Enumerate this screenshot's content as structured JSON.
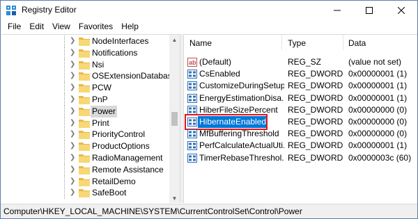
{
  "window": {
    "title": "Registry Editor"
  },
  "menu": [
    "File",
    "Edit",
    "View",
    "Favorites",
    "Help"
  ],
  "tree": {
    "items": [
      {
        "label": "NodeInterfaces",
        "selected": false
      },
      {
        "label": "Notifications",
        "selected": false
      },
      {
        "label": "Nsi",
        "selected": false
      },
      {
        "label": "OSExtensionDatabase",
        "selected": false
      },
      {
        "label": "PCW",
        "selected": false
      },
      {
        "label": "PnP",
        "selected": false
      },
      {
        "label": "Power",
        "selected": true
      },
      {
        "label": "Print",
        "selected": false
      },
      {
        "label": "PriorityControl",
        "selected": false
      },
      {
        "label": "ProductOptions",
        "selected": false
      },
      {
        "label": "RadioManagement",
        "selected": false
      },
      {
        "label": "Remote Assistance",
        "selected": false
      },
      {
        "label": "RetailDemo",
        "selected": false
      },
      {
        "label": "SafeBoot",
        "selected": false
      }
    ]
  },
  "list": {
    "columns": {
      "name": "Name",
      "type": "Type",
      "data": "Data"
    },
    "rows": [
      {
        "name": "(Default)",
        "type": "REG_SZ",
        "data": "(value not set)",
        "icon": "string-value-icon"
      },
      {
        "name": "CsEnabled",
        "type": "REG_DWORD",
        "data": "0x00000001 (1)",
        "icon": "dword-value-icon"
      },
      {
        "name": "CustomizeDuringSetup",
        "type": "REG_DWORD",
        "data": "0x00000001 (1)",
        "icon": "dword-value-icon"
      },
      {
        "name": "EnergyEstimationDisa...",
        "type": "REG_DWORD",
        "data": "0x00000001 (1)",
        "icon": "dword-value-icon"
      },
      {
        "name": "HiberFileSizePercent",
        "type": "REG_DWORD",
        "data": "0x00000000 (0)",
        "icon": "dword-value-icon"
      },
      {
        "name": "HibernateEnabled",
        "type": "REG_DWORD",
        "data": "0x00000000 (0)",
        "icon": "dword-value-icon",
        "highlighted": true
      },
      {
        "name": "MfBufferingThreshold",
        "type": "REG_DWORD",
        "data": "0x00000000 (0)",
        "icon": "dword-value-icon"
      },
      {
        "name": "PerfCalculateActualUti...",
        "type": "REG_DWORD",
        "data": "0x00000001 (1)",
        "icon": "dword-value-icon"
      },
      {
        "name": "TimerRebaseThreshol...",
        "type": "REG_DWORD",
        "data": "0x0000003c (60)",
        "icon": "dword-value-icon"
      }
    ]
  },
  "statusbar": {
    "path": "Computer\\HKEY_LOCAL_MACHINE\\SYSTEM\\CurrentControlSet\\Control\\Power"
  },
  "colors": {
    "selection": "#0078d7",
    "highlight_box": "#e0141c",
    "folder": "#f8d775"
  }
}
